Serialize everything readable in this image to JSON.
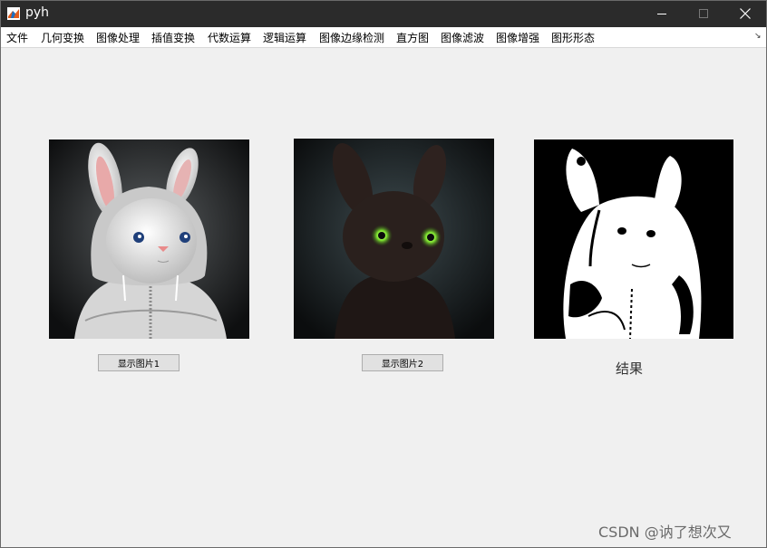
{
  "window": {
    "title": "pyh"
  },
  "menu": [
    "文件",
    "几何变换",
    "图像处理",
    "插值变换",
    "代数运算",
    "逻辑运算",
    "图像边缘检测",
    "直方图",
    "图像滤波",
    "图像增强",
    "图形形态"
  ],
  "buttons": {
    "show_image1": "显示图片1",
    "show_image2": "显示图片2"
  },
  "result_label": "结果",
  "watermark": "CSDN @讷了想次又"
}
